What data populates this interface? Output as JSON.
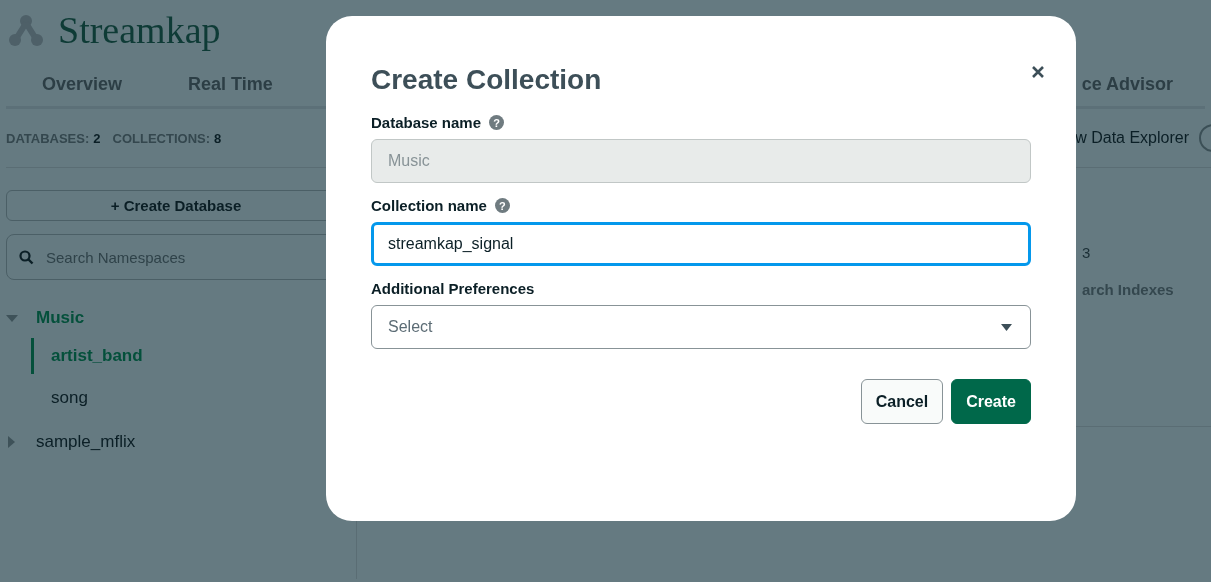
{
  "logo": {
    "text": "Streamkap"
  },
  "tabs": [
    {
      "label": "Overview"
    },
    {
      "label": "Real Time"
    },
    {
      "label": "ce Advisor"
    }
  ],
  "stats": [
    {
      "label": "DATABASES:",
      "value": "2"
    },
    {
      "label": "COLLECTIONS:",
      "value": "8"
    }
  ],
  "create_database_button": {
    "label": "Create Database",
    "icon": "+"
  },
  "search": {
    "placeholder": "Search Namespaces"
  },
  "tree": [
    {
      "label": "Music",
      "expanded": true,
      "children": [
        {
          "label": "artist_band",
          "selected": true
        },
        {
          "label": "song",
          "selected": false
        }
      ]
    },
    {
      "label": "sample_mflix",
      "expanded": false
    }
  ],
  "main": {
    "explorer_link": "w Data Explorer",
    "count": "3",
    "indexes_label": "arch Indexes"
  },
  "modal": {
    "title": "Create Collection",
    "fields": [
      {
        "kind": "text",
        "label": "Database name",
        "help": "?",
        "value": "Music",
        "disabled": true,
        "focused": false
      },
      {
        "kind": "text",
        "label": "Collection name",
        "help": "?",
        "value": "streamkap_signal",
        "disabled": false,
        "focused": true
      },
      {
        "kind": "select",
        "label": "Additional Preferences",
        "placeholder": "Select",
        "disabled": false,
        "focused": false
      }
    ],
    "buttons": [
      {
        "label": "Cancel",
        "kind": "secondary"
      },
      {
        "label": "Create",
        "kind": "primary"
      }
    ]
  }
}
